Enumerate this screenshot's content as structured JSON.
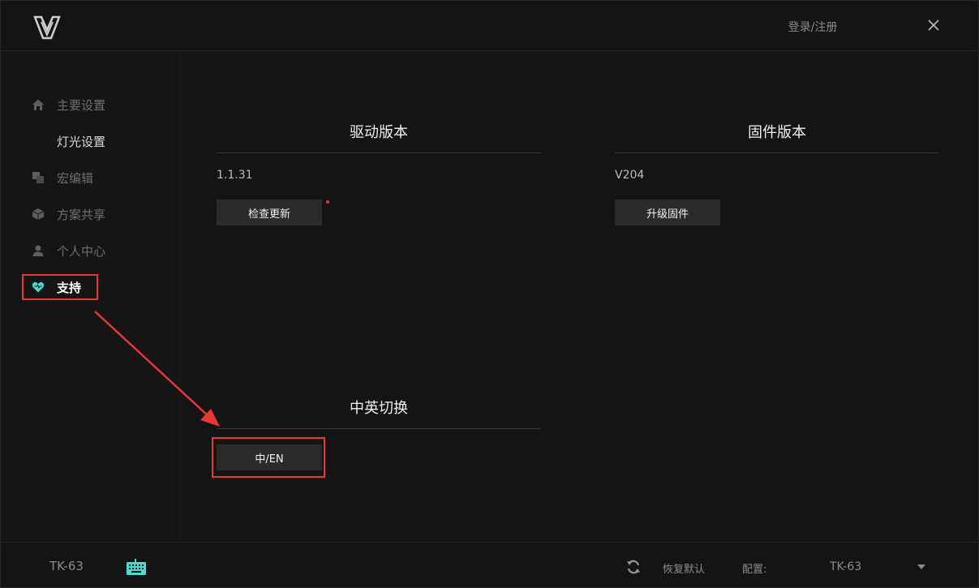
{
  "header": {
    "login_label": "登录/注册"
  },
  "sidebar": {
    "items": [
      {
        "label": "主要设置",
        "icon": "home-icon"
      },
      {
        "label": "灯光设置",
        "icon": ""
      },
      {
        "label": "宏编辑",
        "icon": "macro-icon"
      },
      {
        "label": "方案共享",
        "icon": "cube-icon"
      },
      {
        "label": "个人中心",
        "icon": "user-icon"
      },
      {
        "label": "支持",
        "icon": "heart-icon"
      }
    ],
    "active_index": 5
  },
  "driver": {
    "title": "驱动版本",
    "version": "1.1.31",
    "button_label": "检查更新"
  },
  "firmware": {
    "title": "固件版本",
    "version": "V204",
    "button_label": "升级固件"
  },
  "language": {
    "title": "中英切换",
    "button_label": "中/EN"
  },
  "footer": {
    "device_name": "TK-63",
    "restore_label": "恢复默认",
    "profile_label": "配置:",
    "profile_value": "TK-63"
  },
  "colors": {
    "accent": "#4dd9cf",
    "annotation_red": "#e53935",
    "background": "#141414",
    "button_bg": "#2b2b2b"
  }
}
